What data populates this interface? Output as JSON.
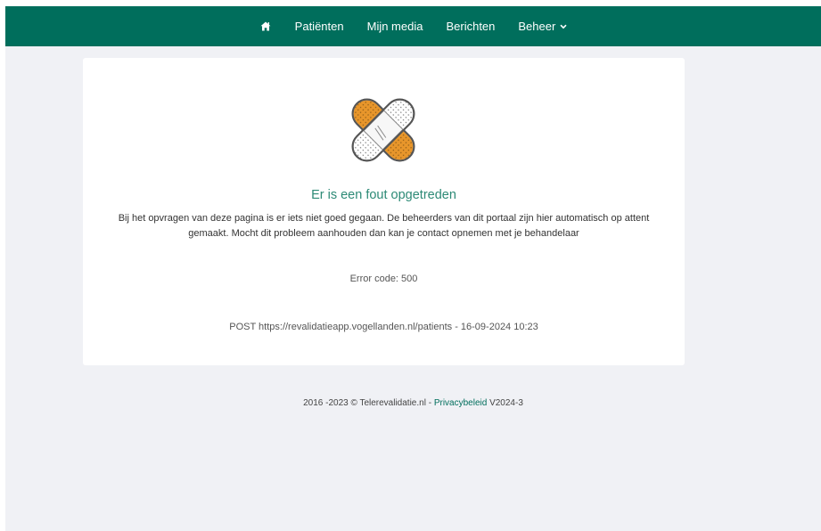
{
  "nav": {
    "home_icon": "home-icon",
    "items": [
      {
        "label": "Patiënten"
      },
      {
        "label": "Mijn media"
      },
      {
        "label": "Berichten"
      },
      {
        "label": "Beheer"
      }
    ],
    "dropdown_icon": "chevron-down-icon"
  },
  "error": {
    "illustration_icon": "crossed-bandage-icon",
    "title": "Er is een fout opgetreden",
    "message": "Bij het opvragen van deze pagina is er iets niet goed gegaan. De beheerders van dit portaal zijn hier automatisch op attent gemaakt. Mocht dit probleem aanhouden dan kan je contact opnemen met je behandelaar",
    "code": "Error code: 500",
    "request": "POST https://revalidatieapp.vogellanden.nl/patients - 16-09-2024 10:23"
  },
  "footer": {
    "copyright": "2016 -2023 © Telerevalidatie.nl - ",
    "privacy_link": "Privacybeleid",
    "version": " V2024-3"
  },
  "colors": {
    "navbar": "#006e5c",
    "accent_title": "#2d8a76",
    "bandage_orange": "#e8962b",
    "background": "#f0f1f5"
  }
}
